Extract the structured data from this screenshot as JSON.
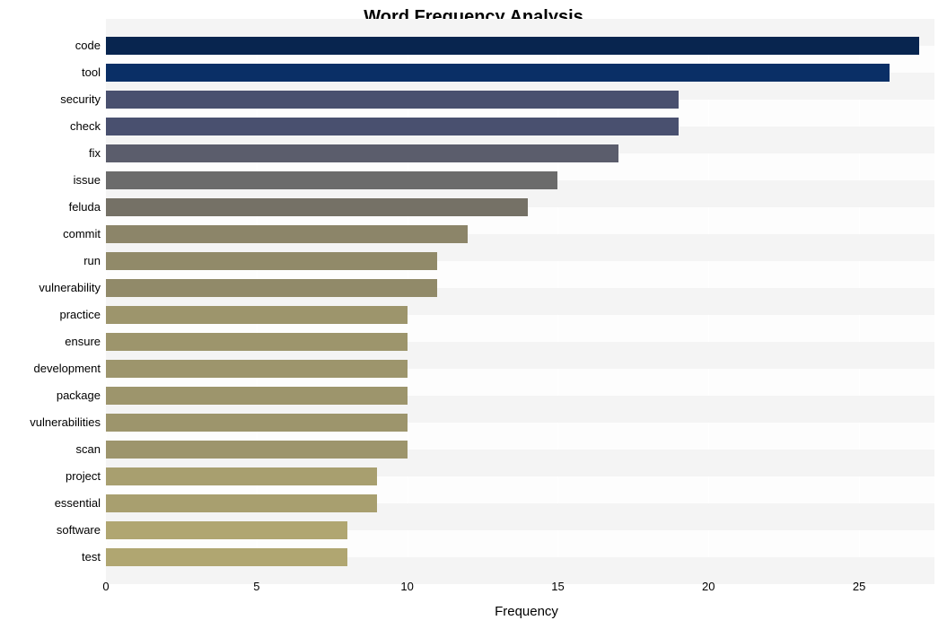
{
  "chart_data": {
    "type": "bar",
    "orientation": "horizontal",
    "title": "Word Frequency Analysis",
    "xlabel": "Frequency",
    "ylabel": "",
    "xlim": [
      0,
      27.5
    ],
    "x_ticks": [
      0,
      5,
      10,
      15,
      20,
      25
    ],
    "categories": [
      "code",
      "tool",
      "security",
      "check",
      "fix",
      "issue",
      "feluda",
      "commit",
      "run",
      "vulnerability",
      "practice",
      "ensure",
      "development",
      "package",
      "vulnerabilities",
      "scan",
      "project",
      "essential",
      "software",
      "test"
    ],
    "values": [
      27,
      26,
      19,
      19,
      17,
      15,
      14,
      12,
      11,
      11,
      10,
      10,
      10,
      10,
      10,
      10,
      9,
      9,
      8,
      8
    ],
    "colors": [
      "#08254f",
      "#0a2f66",
      "#49506f",
      "#49506f",
      "#5b5d6c",
      "#6b6b6b",
      "#757166",
      "#8c8569",
      "#918a69",
      "#918a69",
      "#9d956c",
      "#9d956c",
      "#9d956c",
      "#9d956c",
      "#9d956c",
      "#9d956c",
      "#a89f6f",
      "#a89f6f",
      "#b0a671",
      "#b0a671"
    ]
  }
}
